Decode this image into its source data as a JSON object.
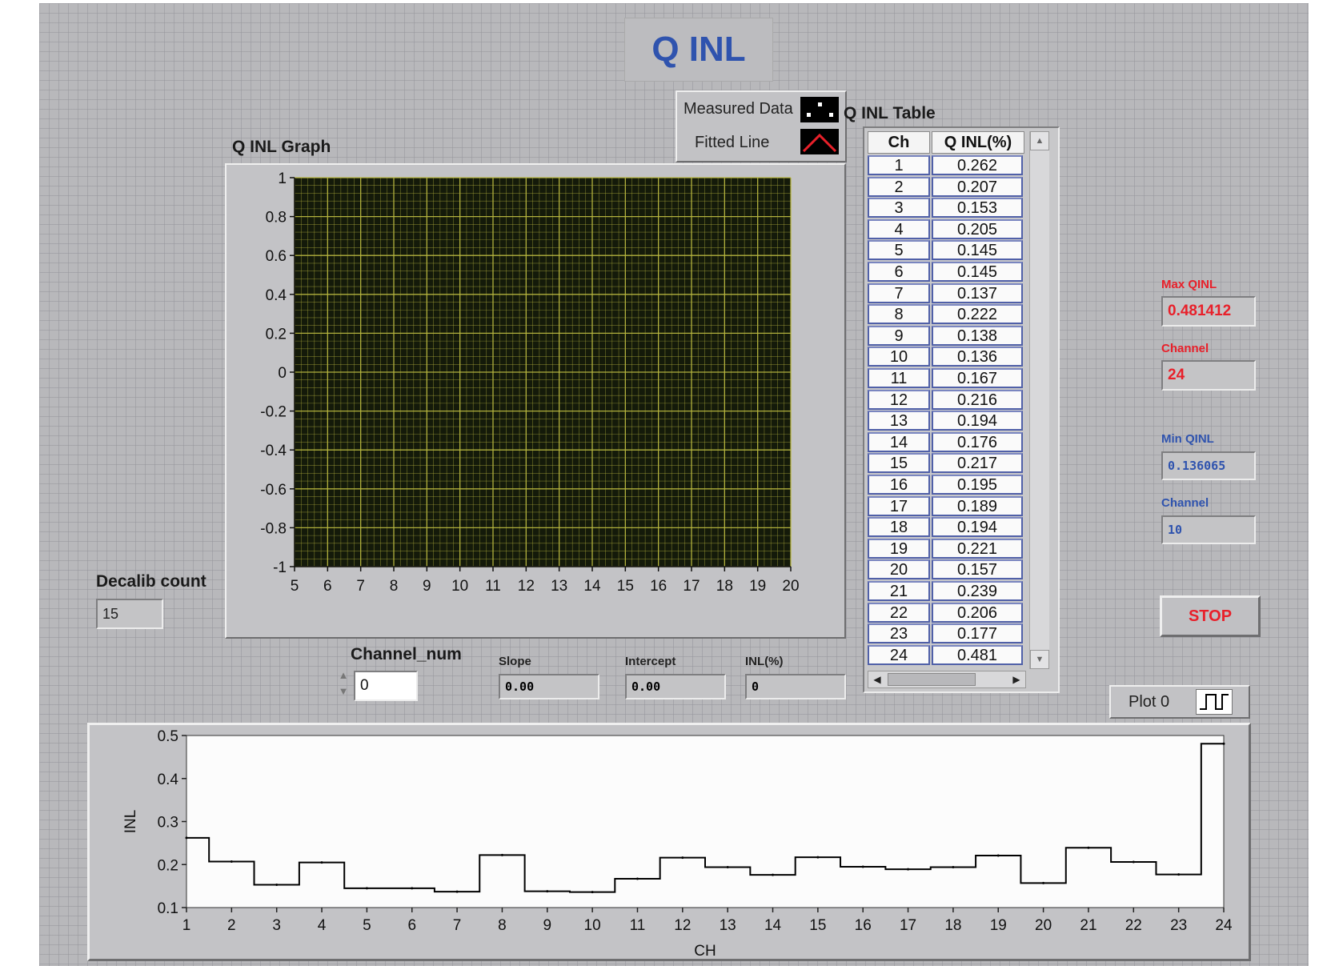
{
  "title": "Q INL",
  "colors": {
    "title": "#2f53ae",
    "max": "#e8202a",
    "min": "#2f53ae",
    "plot_bg": "#141a0a",
    "grid": "#b9b840"
  },
  "legend": {
    "measured_label": "Measured Data",
    "fitted_label": "Fitted Line",
    "measured_icon": "scatter-points-icon",
    "fitted_icon": "fitted-line-icon"
  },
  "graph": {
    "label": "Q INL Graph",
    "x_ticks": [
      "5",
      "6",
      "7",
      "8",
      "9",
      "10",
      "11",
      "12",
      "13",
      "14",
      "15",
      "16",
      "17",
      "18",
      "19",
      "20"
    ],
    "y_ticks": [
      "1",
      "0.8",
      "0.6",
      "0.4",
      "0.2",
      "0",
      "-0.2",
      "-0.4",
      "-0.6",
      "-0.8",
      "-1"
    ]
  },
  "table": {
    "label": "Q INL Table",
    "headers": [
      "Ch",
      "Q INL(%)"
    ],
    "rows": [
      [
        "1",
        "0.262"
      ],
      [
        "2",
        "0.207"
      ],
      [
        "3",
        "0.153"
      ],
      [
        "4",
        "0.205"
      ],
      [
        "5",
        "0.145"
      ],
      [
        "6",
        "0.145"
      ],
      [
        "7",
        "0.137"
      ],
      [
        "8",
        "0.222"
      ],
      [
        "9",
        "0.138"
      ],
      [
        "10",
        "0.136"
      ],
      [
        "11",
        "0.167"
      ],
      [
        "12",
        "0.216"
      ],
      [
        "13",
        "0.194"
      ],
      [
        "14",
        "0.176"
      ],
      [
        "15",
        "0.217"
      ],
      [
        "16",
        "0.195"
      ],
      [
        "17",
        "0.189"
      ],
      [
        "18",
        "0.194"
      ],
      [
        "19",
        "0.221"
      ],
      [
        "20",
        "0.157"
      ],
      [
        "21",
        "0.239"
      ],
      [
        "22",
        "0.206"
      ],
      [
        "23",
        "0.177"
      ],
      [
        "24",
        "0.481"
      ]
    ]
  },
  "max": {
    "label": "Max QINL",
    "value": "0.481412",
    "channel_label": "Channel",
    "channel_value": "24"
  },
  "min": {
    "label": "Min QINL",
    "value": "0.136065",
    "channel_label": "Channel",
    "channel_value": "10"
  },
  "stop_label": "STOP",
  "decalib": {
    "label": "Decalib count",
    "value": "15"
  },
  "channel_num": {
    "label": "Channel_num",
    "value": "0"
  },
  "slope": {
    "label": "Slope",
    "value": "0.00"
  },
  "intercept": {
    "label": "Intercept",
    "value": "0.00"
  },
  "inl_pct": {
    "label": "INL(%)",
    "value": "0"
  },
  "plot_legend": {
    "label": "Plot 0",
    "icon": "step-plot-icon"
  },
  "chart_data": {
    "type": "line",
    "step": true,
    "xlabel": "CH",
    "ylabel": "INL",
    "x": [
      1,
      2,
      3,
      4,
      5,
      6,
      7,
      8,
      9,
      10,
      11,
      12,
      13,
      14,
      15,
      16,
      17,
      18,
      19,
      20,
      21,
      22,
      23,
      24
    ],
    "series": [
      {
        "values": [
          0.262,
          0.207,
          0.153,
          0.205,
          0.145,
          0.145,
          0.137,
          0.222,
          0.138,
          0.136,
          0.167,
          0.216,
          0.194,
          0.176,
          0.217,
          0.195,
          0.189,
          0.194,
          0.221,
          0.157,
          0.239,
          0.206,
          0.177,
          0.481
        ]
      }
    ],
    "xlim": [
      1,
      24
    ],
    "ylim": [
      0.1,
      0.5
    ],
    "x_ticks": [
      "1",
      "2",
      "3",
      "4",
      "5",
      "6",
      "7",
      "8",
      "9",
      "10",
      "11",
      "12",
      "13",
      "14",
      "15",
      "16",
      "17",
      "18",
      "19",
      "20",
      "21",
      "22",
      "23",
      "24"
    ],
    "y_ticks": [
      "0.5",
      "0.4",
      "0.3",
      "0.2",
      "0.1"
    ]
  }
}
